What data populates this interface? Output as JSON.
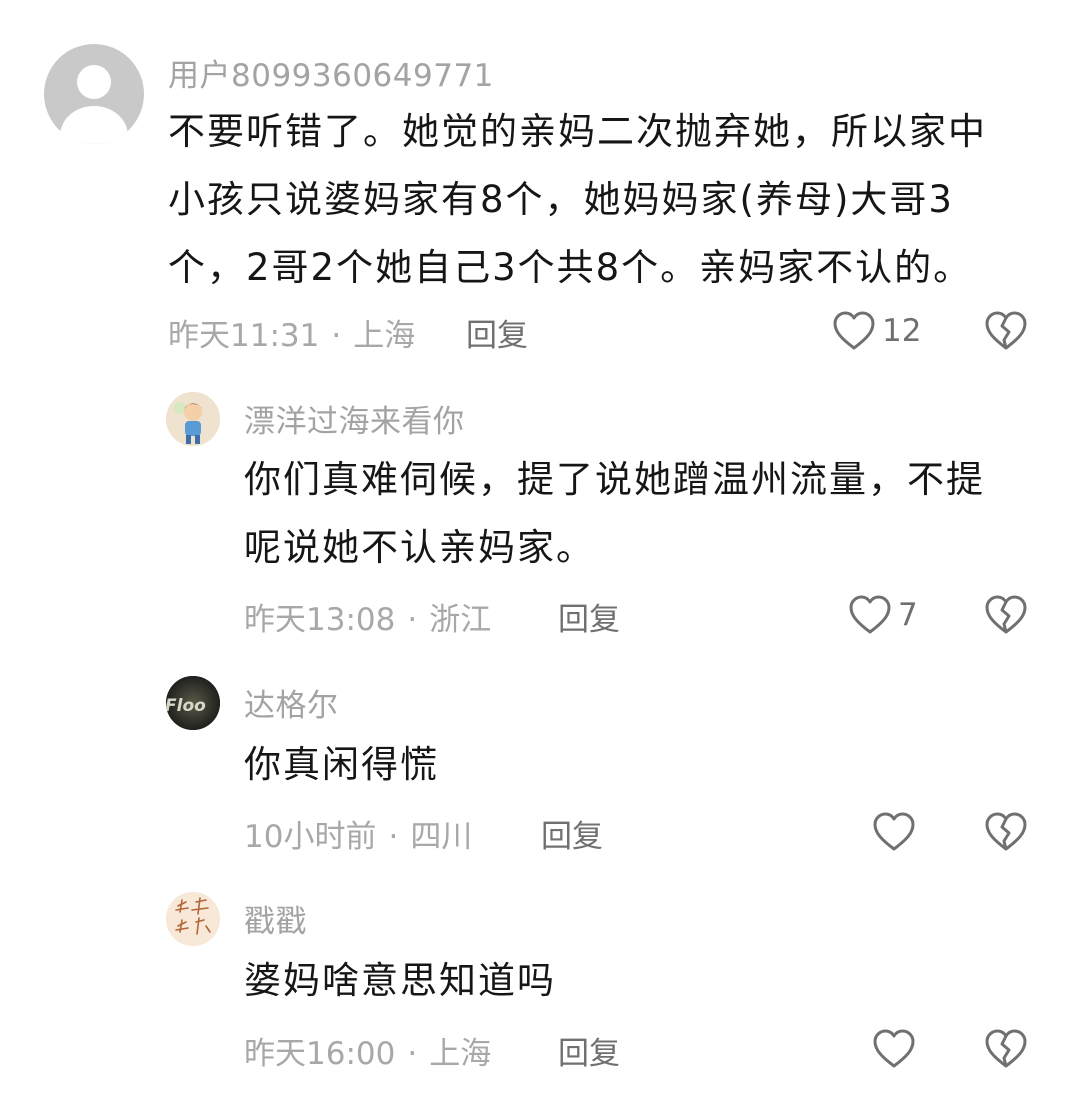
{
  "comments": [
    {
      "username": "用户8099360649771",
      "content": [
        "不要听错了。她觉的亲妈二次抛弃她，所以家中",
        "小孩只说婆妈家有8个，她妈妈家(养母)大哥3",
        "个，2哥2个她自己3个共8个。亲妈家不认的。"
      ],
      "time": "昨天11:31",
      "location": "上海",
      "reply_label": "回复",
      "likes": "12"
    },
    {
      "username": "漂洋过海来看你",
      "content": [
        "你们真难伺候，提了说她蹭温州流量，不提",
        "呢说她不认亲妈家。"
      ],
      "time": "昨天13:08",
      "location": "浙江",
      "reply_label": "回复",
      "likes": "7"
    },
    {
      "username": "达格尔",
      "avatar_text": "Floo",
      "content": [
        "你真闲得慌"
      ],
      "time": "10小时前",
      "location": "四川",
      "reply_label": "回复",
      "likes": ""
    },
    {
      "username": "戳戳",
      "content": [
        "婆妈啥意思知道吗"
      ],
      "time": "昨天16:00",
      "location": "上海",
      "reply_label": "回复",
      "likes": ""
    }
  ],
  "colors": {
    "username": "#a3a3a3",
    "content": "#161616",
    "meta": "#a8a8a8",
    "action": "#707070"
  },
  "icons": {
    "like": "heart-outline-icon",
    "dislike": "broken-heart-outline-icon"
  }
}
